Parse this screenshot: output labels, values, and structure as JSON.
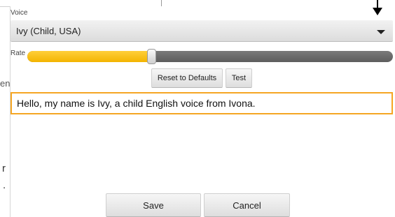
{
  "background": {
    "fragments": [
      "en",
      "r",
      "."
    ]
  },
  "dialog": {
    "voice": {
      "label": "Voice",
      "selected": "Ivy (Child, USA)",
      "dropdown_icon": "chevron-down-icon"
    },
    "pointer_icon": "arrow-down-icon",
    "rate": {
      "label": "Rate",
      "value_fraction": 0.34,
      "fill_color": "#f3b400",
      "track_color": "#666666"
    },
    "buttons": {
      "reset_label": "Reset to Defaults",
      "test_label": "Test"
    },
    "text_input": {
      "value": "Hello, my name is Ivy, a child English voice from Ivona.",
      "border_color": "#f5a623"
    },
    "footer": {
      "save_label": "Save",
      "cancel_label": "Cancel"
    }
  }
}
